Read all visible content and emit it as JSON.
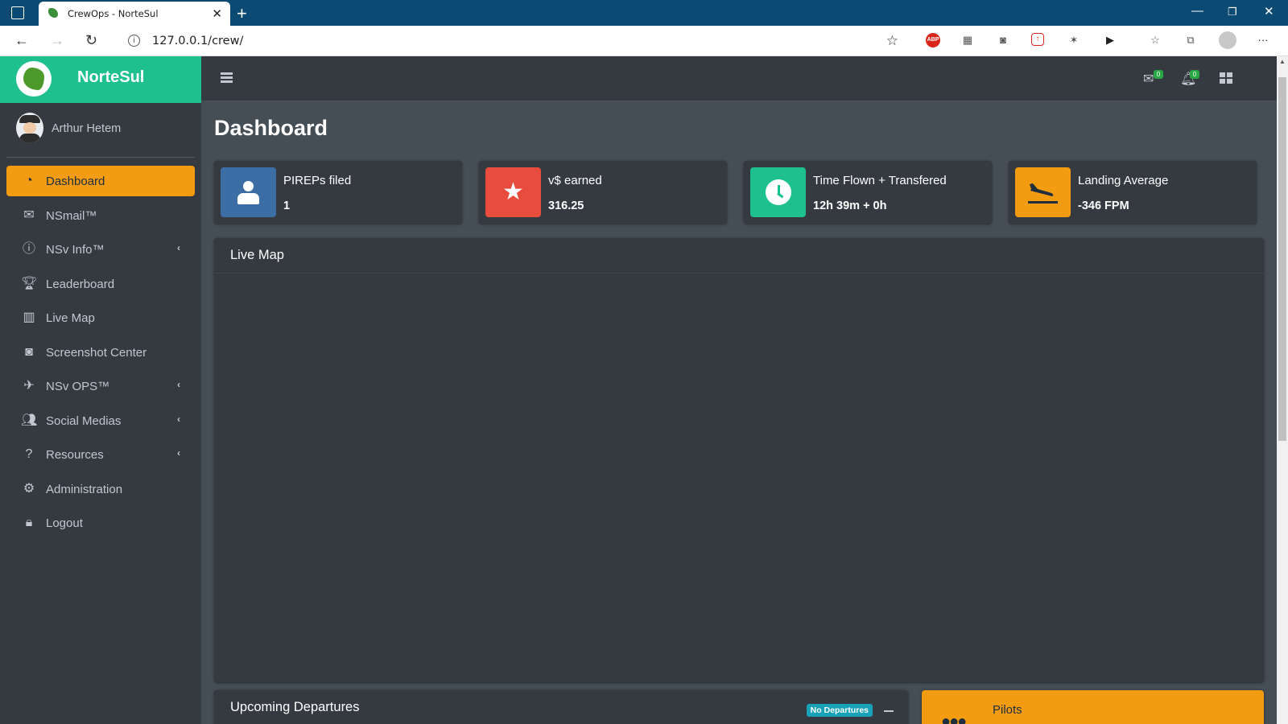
{
  "browser": {
    "tab_title": "CrewOps - NorteSul",
    "url": "127.0.0.1/crew/"
  },
  "sidebar": {
    "brand": "NorteSul",
    "user_name": "Arthur Hetem",
    "items": [
      {
        "label": "Dashboard",
        "icon": "tachometer-icon",
        "active": true
      },
      {
        "label": "NSmail™",
        "icon": "envelope-icon"
      },
      {
        "label": "NSv Info™",
        "icon": "info-circle-icon",
        "has_submenu": true
      },
      {
        "label": "Leaderboard",
        "icon": "trophy-icon"
      },
      {
        "label": "Live Map",
        "icon": "map-icon"
      },
      {
        "label": "Screenshot Center",
        "icon": "camera-icon"
      },
      {
        "label": "NSv OPS™",
        "icon": "plane-departure-icon",
        "has_submenu": true
      },
      {
        "label": "Social Medias",
        "icon": "users-icon",
        "has_submenu": true
      },
      {
        "label": "Resources",
        "icon": "question-circle-icon",
        "has_submenu": true
      },
      {
        "label": "Administration",
        "icon": "cog-icon"
      },
      {
        "label": "Logout",
        "icon": "lock-icon"
      }
    ]
  },
  "topbar": {
    "mail_count": "0",
    "notification_count": "0"
  },
  "main": {
    "page_title": "Dashboard",
    "info_boxes": [
      {
        "label": "PIREPs filed",
        "value": "1",
        "color": "#3c6ea5",
        "icon": "user-icon"
      },
      {
        "label": "v$ earned",
        "value": "316.25",
        "color": "#e74c3c",
        "icon": "star-icon"
      },
      {
        "label": "Time Flown + Transfered",
        "value": "12h 39m + 0h",
        "color": "#1ec08e",
        "icon": "clock-icon"
      },
      {
        "label": "Landing Average",
        "value": "-346 FPM",
        "color": "#f39c12",
        "icon": "plane-arrival-icon"
      }
    ],
    "live_map_title": "Live Map",
    "upcoming_title": "Upcoming Departures",
    "upcoming_badge": "No Departures",
    "pilots_title": "Pilots"
  },
  "colors": {
    "accent": "#f39c12",
    "brand": "#1ec08e",
    "sidebar_bg": "#343a40",
    "content_bg": "#454d55"
  }
}
